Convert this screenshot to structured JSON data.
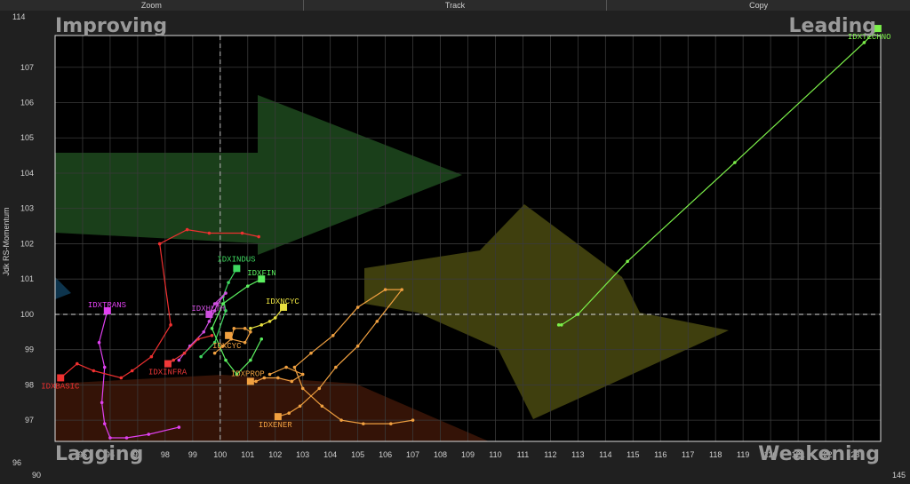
{
  "toolbar": {
    "zoom": "Zoom",
    "track": "Track",
    "copy": "Copy"
  },
  "quadrants": {
    "improving": "Improving",
    "leading": "Leading",
    "lagging": "Lagging",
    "weakening": "Weakening"
  },
  "colors": {
    "IDXTECHNO": "#7cf04a",
    "IDXINDUS": "#3ed860",
    "IDXFIN": "#5cf060",
    "IDXTRANS": "#e040f0",
    "IDXHLTH": "#d050e0",
    "IDXNCYC": "#e8e040",
    "IDXCYC": "#f0a040",
    "IDXBASIC": "#f03030",
    "IDXINFRA": "#f03838",
    "IDXPROP": "#f0a040",
    "IDXENER": "#f0a040"
  },
  "chart_data": {
    "type": "scatter",
    "ylabel": "Jdk RS-Momentum",
    "xlim": [
      94,
      124
    ],
    "ylim": [
      96.4,
      107.9
    ],
    "x_ticks": [
      95,
      96,
      97,
      98,
      99,
      100,
      101,
      102,
      103,
      104,
      105,
      106,
      107,
      108,
      109,
      110,
      111,
      112,
      113,
      114,
      115,
      116,
      117,
      118,
      119,
      120,
      121,
      122,
      123
    ],
    "y_ticks": [
      97,
      98,
      99,
      100,
      101,
      102,
      103,
      104,
      105,
      106,
      107
    ],
    "y_axis_top_label": "114",
    "y_axis_bottom_label": "96",
    "x_axis_left_label": "90",
    "x_axis_right_label": "145",
    "center": [
      100,
      100
    ],
    "series": [
      {
        "name": "IDXTECHNO",
        "points": [
          [
            112.3,
            99.7
          ],
          [
            112.4,
            99.7
          ],
          [
            113,
            100
          ],
          [
            114.8,
            101.5
          ],
          [
            118.7,
            104.3
          ],
          [
            123.4,
            107.7
          ],
          [
            123.9,
            108.1
          ]
        ]
      },
      {
        "name": "IDXINDUS",
        "points": [
          [
            99.3,
            98.8
          ],
          [
            99.8,
            99.2
          ],
          [
            100.2,
            100.1
          ],
          [
            100.1,
            100.5
          ],
          [
            100.3,
            100.9
          ],
          [
            100.6,
            101.3
          ]
        ]
      },
      {
        "name": "IDXFIN",
        "points": [
          [
            101.5,
            99.3
          ],
          [
            101.1,
            98.7
          ],
          [
            100.6,
            98.3
          ],
          [
            100.2,
            98.7
          ],
          [
            99.7,
            99.6
          ],
          [
            100.1,
            100.3
          ],
          [
            101,
            100.8
          ],
          [
            101.5,
            101
          ]
        ]
      },
      {
        "name": "IDXTRANS",
        "points": [
          [
            98.5,
            96.8
          ],
          [
            97.4,
            96.6
          ],
          [
            96.6,
            96.5
          ],
          [
            96,
            96.5
          ],
          [
            95.8,
            96.9
          ],
          [
            95.7,
            97.5
          ],
          [
            95.8,
            98.5
          ],
          [
            95.6,
            99.2
          ],
          [
            95.9,
            100.1
          ]
        ]
      },
      {
        "name": "IDXHLTH",
        "points": [
          [
            98.5,
            98.7
          ],
          [
            98.9,
            99.1
          ],
          [
            99.4,
            99.5
          ],
          [
            99.6,
            99.8
          ],
          [
            99.8,
            100.1
          ],
          [
            99.9,
            100.3
          ],
          [
            100.2,
            100.6
          ],
          [
            99.8,
            100.3
          ],
          [
            99.6,
            100
          ]
        ]
      },
      {
        "name": "IDXNCYC",
        "points": [
          [
            101.1,
            99.6
          ],
          [
            101.5,
            99.7
          ],
          [
            101.8,
            99.8
          ],
          [
            102,
            99.9
          ],
          [
            102.3,
            100.2
          ]
        ]
      },
      {
        "name": "IDXCYC",
        "points": [
          [
            99.8,
            98.9
          ],
          [
            100.1,
            99.1
          ],
          [
            100.4,
            99.3
          ],
          [
            100.5,
            99.6
          ],
          [
            100.9,
            99.6
          ],
          [
            101.1,
            99.5
          ],
          [
            100.9,
            99.2
          ],
          [
            100.4,
            99.3
          ],
          [
            100.3,
            99.4
          ]
        ]
      },
      {
        "name": "IDXBASIC",
        "points": [
          [
            101.4,
            102.2
          ],
          [
            100.8,
            102.3
          ],
          [
            99.6,
            102.3
          ],
          [
            98.8,
            102.4
          ],
          [
            97.8,
            102
          ],
          [
            98.2,
            99.7
          ],
          [
            97.5,
            98.8
          ],
          [
            96.8,
            98.4
          ],
          [
            96.4,
            98.2
          ],
          [
            95.4,
            98.4
          ],
          [
            94.8,
            98.6
          ],
          [
            94.2,
            98.2
          ]
        ]
      },
      {
        "name": "IDXINFRA",
        "points": [
          [
            99.7,
            99.4
          ],
          [
            99.2,
            99.3
          ],
          [
            98.7,
            98.9
          ],
          [
            98.3,
            98.7
          ],
          [
            98.1,
            98.6
          ]
        ]
      },
      {
        "name": "IDXPROP",
        "points": [
          [
            101.8,
            98.3
          ],
          [
            102.4,
            98.5
          ],
          [
            103,
            98.3
          ],
          [
            102.6,
            98.1
          ],
          [
            102.1,
            98.2
          ],
          [
            101.6,
            98.2
          ],
          [
            101.3,
            98.1
          ],
          [
            101.1,
            98.1
          ]
        ]
      },
      {
        "name": "IDXENER",
        "points": [
          [
            107,
            97
          ],
          [
            106.2,
            96.9
          ],
          [
            105.2,
            96.9
          ],
          [
            104.4,
            97
          ],
          [
            103.7,
            97.4
          ],
          [
            103,
            97.9
          ],
          [
            102.7,
            98.5
          ],
          [
            103.3,
            98.9
          ],
          [
            104.1,
            99.4
          ],
          [
            105,
            100.2
          ],
          [
            106,
            100.7
          ],
          [
            106.6,
            100.7
          ],
          [
            105.7,
            99.8
          ],
          [
            105,
            99.1
          ],
          [
            104.2,
            98.5
          ],
          [
            103.6,
            97.9
          ],
          [
            102.9,
            97.4
          ],
          [
            102.5,
            97.2
          ],
          [
            102.1,
            97.1
          ]
        ]
      }
    ]
  }
}
